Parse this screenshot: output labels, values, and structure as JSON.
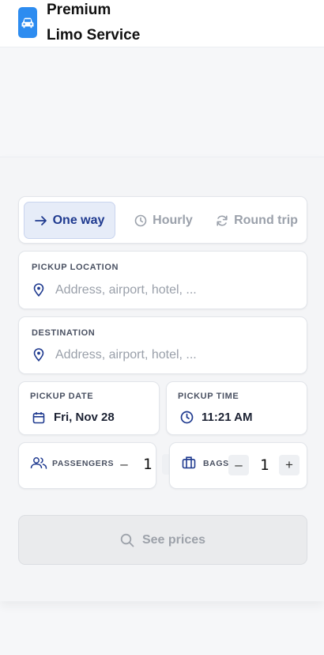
{
  "header": {
    "brand_line1": "Premium",
    "brand_line2": "Limo Service",
    "logo_icon": "car-icon",
    "accent": "#2d8cf0"
  },
  "booking": {
    "tabs": [
      {
        "label": "One way",
        "icon": "arrow-right-icon",
        "active": true
      },
      {
        "label": "Hourly",
        "icon": "clock-icon",
        "active": false
      },
      {
        "label": "Round trip",
        "icon": "refresh-icon",
        "active": false
      }
    ],
    "pickup": {
      "label": "PICKUP LOCATION",
      "placeholder": "Address, airport, hotel, ..."
    },
    "destination": {
      "label": "DESTINATION",
      "placeholder": "Address, airport, hotel, ..."
    },
    "date": {
      "label": "PICKUP DATE",
      "value": "Fri, Nov 28"
    },
    "time": {
      "label": "PICKUP TIME",
      "value": "11:21 AM"
    },
    "passengers": {
      "label": "PASSENGERS",
      "value": "1",
      "minus": "–"
    },
    "bags": {
      "label": "BAGS",
      "value": "1",
      "minus": "–",
      "plus": "+"
    },
    "cta_label": "See prices"
  }
}
